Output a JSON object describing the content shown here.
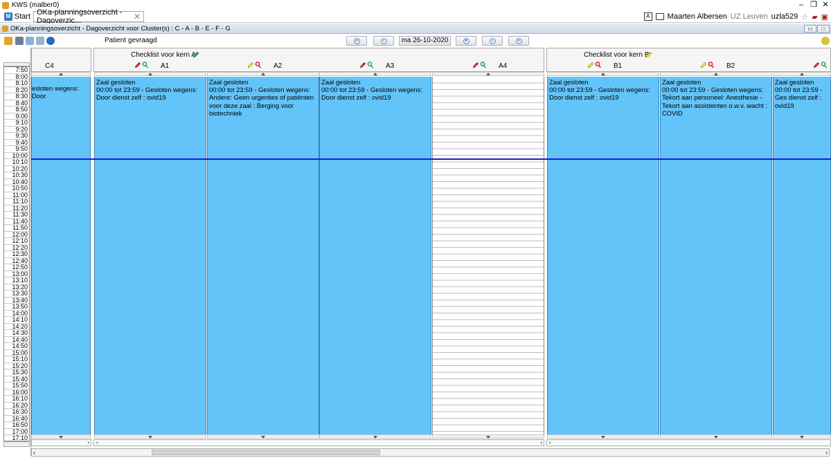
{
  "window": {
    "title": "KWS (malber0)",
    "minimize": "–",
    "restore": "❐",
    "close": "✕"
  },
  "tabs": {
    "start_label": "Start",
    "doc_label": "OKa-planningsoverzicht - Dagoverzic...",
    "close": "✕"
  },
  "user": {
    "name": "Maarten Albersen",
    "org": "UZ Leuven",
    "login": "uzla529"
  },
  "frame": {
    "title": "OKa-planningsoverzicht - Dagoverzicht voor Cluster(s) : C - A - B - E - F - G"
  },
  "toolbar": {
    "patient_label": "Patient gevraagd",
    "date": "ma 26-10-2020",
    "nav": [
      "«",
      "‹",
      "▾",
      "›",
      "»"
    ]
  },
  "checklists": [
    {
      "label": "Checklist voor kern A",
      "pen_color": "#2fa84a"
    },
    {
      "label": "Checklist voor kern B",
      "pen_color": "#f2e21a"
    }
  ],
  "times": [
    "7:50",
    "8:00",
    "8:10",
    "8:20",
    "8:30",
    "8:40",
    "8:50",
    "9:00",
    "9:10",
    "9:20",
    "9:30",
    "9:40",
    "9:50",
    "10:00",
    "10:10",
    "10:20",
    "10:30",
    "10:40",
    "10:50",
    "11:00",
    "11:10",
    "11:20",
    "11:30",
    "11:40",
    "11:50",
    "12:00",
    "12:10",
    "12:20",
    "12:30",
    "12:40",
    "12:50",
    "13:00",
    "13:10",
    "13:20",
    "13:30",
    "13:40",
    "13:50",
    "14:00",
    "14:10",
    "14:20",
    "14:30",
    "14:40",
    "14:50",
    "15:00",
    "15:10",
    "15:20",
    "15:30",
    "15:40",
    "15:50",
    "16:00",
    "16:10",
    "16:20",
    "16:30",
    "16:40",
    "16:50",
    "17:00",
    "17:10"
  ],
  "rooms": [
    {
      "name": "C4",
      "lines": [
        "esloten wegens: Door"
      ],
      "pens": []
    },
    {
      "name": "A1",
      "lines": [
        "Zaal gesloten",
        "00:00 tot 23:59 - Gesloten wegens: Door dienst zelf : ovid19"
      ],
      "pens": [
        "#e8242a",
        "#2fa84a"
      ]
    },
    {
      "name": "A2",
      "lines": [
        "Zaal gesloten",
        "00:00 tot 23:59 - Gesloten wegens: Andere: Geen urgenties of patiënten voor deze zaal : Berging voor biotechniek"
      ],
      "pens": [
        "#f2e21a",
        "#e8242a"
      ]
    },
    {
      "name": "A3",
      "lines": [
        "Zaal gesloten",
        "00:00 tot 23:59 - Gesloten wegens: Door dienst zelf : ovid19"
      ],
      "pens": [
        "#e8242a",
        "#2fa84a"
      ]
    },
    {
      "name": "A4",
      "lines": [],
      "pens": [
        "#e8242a",
        "#2fa84a"
      ]
    },
    {
      "name": "B1",
      "lines": [
        "Zaal gesloten",
        "00:00 tot 23:59 - Gesloten wegens: Door dienst zelf : ovid19"
      ],
      "pens": [
        "#f2e21a",
        "#e8242a"
      ]
    },
    {
      "name": "B2",
      "lines": [
        "Zaal gesloten",
        "00:00 tot 23:59 - Gesloten wegens: Tekort aan personeel: Anesthesie - Tekort aan assistenten o.w.v. wacht : COVID"
      ],
      "pens": [
        "#f2e21a",
        "#e8242a"
      ]
    },
    {
      "name": "",
      "lines": [
        "Zaal gesloten",
        "00:00 tot 23:59 - Ges dienst zelf : ovid19"
      ],
      "pens": [
        "#e8242a",
        "#2fa84a"
      ]
    }
  ],
  "scroll": {
    "left": "‹",
    "right": "›"
  }
}
